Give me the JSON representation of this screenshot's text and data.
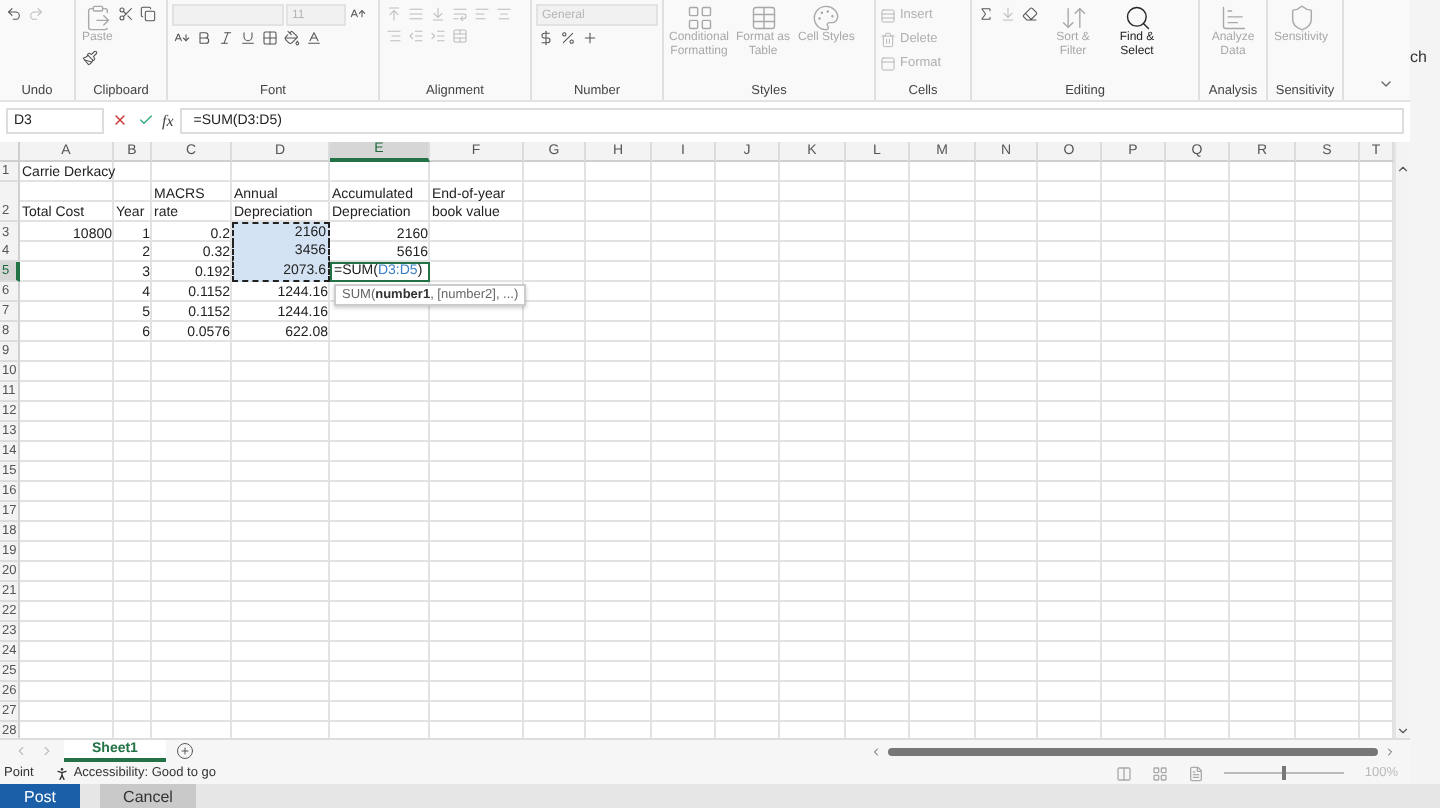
{
  "ribbon": {
    "groups": [
      {
        "label": "Undo",
        "items": [
          {
            "kind": "icon",
            "disabled": false
          },
          {
            "kind": "icon",
            "disabled": true
          }
        ]
      },
      {
        "label": "Clipboard",
        "items": [
          {
            "kind": "big",
            "label": "Paste",
            "disabled": true
          },
          {
            "kind": "icon",
            "disabled": false
          },
          {
            "kind": "icon",
            "disabled": false
          },
          {
            "kind": "icon",
            "disabled": false
          }
        ]
      },
      {
        "label": "Font",
        "items": [
          {
            "kind": "field",
            "disabled": true
          },
          {
            "kind": "field",
            "value": "11",
            "disabled": true
          },
          {
            "kind": "icon",
            "disabled": false
          },
          {
            "kind": "icon",
            "disabled": false
          },
          {
            "kind": "icon",
            "disabled": false
          },
          {
            "kind": "icon",
            "disabled": false
          },
          {
            "kind": "icon",
            "disabled": false
          },
          {
            "kind": "icon",
            "disabled": false
          },
          {
            "kind": "icon",
            "disabled": false
          },
          {
            "kind": "icon",
            "disabled": false
          }
        ]
      },
      {
        "label": "Alignment",
        "items": [
          {
            "kind": "icon",
            "disabled": true
          },
          {
            "kind": "icon",
            "disabled": true
          },
          {
            "kind": "icon",
            "disabled": true
          },
          {
            "kind": "icon",
            "disabled": true
          },
          {
            "kind": "icon",
            "disabled": true
          },
          {
            "kind": "icon",
            "disabled": true
          },
          {
            "kind": "icon",
            "disabled": true
          },
          {
            "kind": "icon",
            "disabled": true
          },
          {
            "kind": "icon",
            "disabled": true
          },
          {
            "kind": "icon",
            "disabled": true
          }
        ]
      },
      {
        "label": "Number",
        "items": [
          {
            "kind": "field",
            "value": "General",
            "disabled": true
          },
          {
            "kind": "icon",
            "disabled": false
          },
          {
            "kind": "icon",
            "disabled": false
          },
          {
            "kind": "icon",
            "disabled": false
          }
        ]
      },
      {
        "label": "Styles",
        "items": [
          {
            "kind": "big",
            "label": "Conditional Formatting",
            "disabled": true
          },
          {
            "kind": "big",
            "label": "Format as Table",
            "disabled": true
          },
          {
            "kind": "big",
            "label": "Cell Styles",
            "disabled": true
          }
        ]
      },
      {
        "label": "Cells",
        "items": [
          {
            "kind": "small",
            "label": "Insert",
            "disabled": true
          },
          {
            "kind": "small",
            "label": "Delete",
            "disabled": true
          },
          {
            "kind": "small",
            "label": "Format",
            "disabled": true
          }
        ]
      },
      {
        "label": "Editing",
        "items": [
          {
            "kind": "icon",
            "disabled": false
          },
          {
            "kind": "icon",
            "disabled": true
          },
          {
            "kind": "icon",
            "disabled": false
          },
          {
            "kind": "big",
            "label": "Sort & Filter",
            "disabled": true
          },
          {
            "kind": "big",
            "label": "Find & Select",
            "disabled": false
          }
        ]
      },
      {
        "label": "Analysis",
        "items": [
          {
            "kind": "big",
            "label": "Analyze Data",
            "disabled": true
          }
        ]
      },
      {
        "label": "Sensitivity",
        "items": [
          {
            "kind": "big",
            "label": "Sensitivity",
            "disabled": true
          }
        ]
      }
    ]
  },
  "formula_bar": {
    "name_box": "D3",
    "function_label": "fx",
    "formula": "=SUM(D3:D5)"
  },
  "columns": [
    {
      "label": "A",
      "selected": false
    },
    {
      "label": "B",
      "selected": false
    },
    {
      "label": "C",
      "selected": false
    },
    {
      "label": "D",
      "selected": false
    },
    {
      "label": "E",
      "selected": true
    },
    {
      "label": "F",
      "selected": false
    },
    {
      "label": "G",
      "selected": false
    },
    {
      "label": "H",
      "selected": false
    },
    {
      "label": "I",
      "selected": false
    },
    {
      "label": "J",
      "selected": false
    },
    {
      "label": "K",
      "selected": false
    },
    {
      "label": "L",
      "selected": false
    },
    {
      "label": "M",
      "selected": false
    },
    {
      "label": "N",
      "selected": false
    },
    {
      "label": "O",
      "selected": false
    },
    {
      "label": "P",
      "selected": false
    },
    {
      "label": "Q",
      "selected": false
    },
    {
      "label": "R",
      "selected": false
    },
    {
      "label": "S",
      "selected": false
    },
    {
      "label": "T",
      "selected": false
    }
  ],
  "rows": [
    {
      "number": "1",
      "selected": false,
      "tall": false,
      "cells": [
        {
          "kind": "text",
          "text": "Carrie Derkacy"
        }
      ]
    },
    {
      "number": "2",
      "selected": false,
      "tall": true,
      "cells": [
        {
          "kind": "text",
          "text": "Total Cost"
        },
        {
          "kind": "text",
          "text": "Year"
        },
        {
          "kind": "text",
          "text": "MACRS rate"
        },
        {
          "kind": "text",
          "text": "Annual Depreciation"
        },
        {
          "kind": "text",
          "text": "Accumulated Depreciation"
        },
        {
          "kind": "text",
          "text": "End-of-year book value"
        }
      ]
    },
    {
      "number": "3",
      "selected": false,
      "tall": false,
      "cells": [
        {
          "kind": "number",
          "text": "10800"
        },
        {
          "kind": "number",
          "text": "1"
        },
        {
          "kind": "number",
          "text": "0.2"
        },
        {
          "kind": "number",
          "text": "2160",
          "in_range": true
        },
        {
          "kind": "number",
          "text": "2160"
        }
      ]
    },
    {
      "number": "4",
      "selected": false,
      "tall": false,
      "cells": [
        {
          "kind": "empty"
        },
        {
          "kind": "number",
          "text": "2"
        },
        {
          "kind": "number",
          "text": "0.32"
        },
        {
          "kind": "number",
          "text": "3456",
          "in_range": true
        },
        {
          "kind": "number",
          "text": "5616"
        }
      ]
    },
    {
      "number": "5",
      "selected": true,
      "tall": false,
      "cells": [
        {
          "kind": "empty"
        },
        {
          "kind": "number",
          "text": "3"
        },
        {
          "kind": "number",
          "text": "0.192"
        },
        {
          "kind": "number",
          "text": "2073.6",
          "in_range": true
        },
        {
          "kind": "edit",
          "parts": [
            {
              "text": "=SUM(",
              "color": "#222222"
            },
            {
              "text": "D3:D5",
              "color": "#3b7fc4"
            },
            {
              "text": ")",
              "color": "#222222"
            }
          ]
        }
      ]
    },
    {
      "number": "6",
      "selected": false,
      "tall": false,
      "cells": [
        {
          "kind": "empty"
        },
        {
          "kind": "number",
          "text": "4"
        },
        {
          "kind": "number",
          "text": "0.1152"
        },
        {
          "kind": "number",
          "text": "1244.16"
        }
      ]
    },
    {
      "number": "7",
      "selected": false,
      "tall": false,
      "cells": [
        {
          "kind": "empty"
        },
        {
          "kind": "number",
          "text": "5"
        },
        {
          "kind": "number",
          "text": "0.1152"
        },
        {
          "kind": "number",
          "text": "1244.16"
        }
      ]
    },
    {
      "number": "8",
      "selected": false,
      "tall": false,
      "cells": [
        {
          "kind": "empty"
        },
        {
          "kind": "number",
          "text": "6"
        },
        {
          "kind": "number",
          "text": "0.0576"
        },
        {
          "kind": "number",
          "text": "622.08"
        }
      ]
    },
    {
      "number": "9",
      "selected": false,
      "tall": false
    },
    {
      "number": "10",
      "selected": false,
      "tall": false
    },
    {
      "number": "11",
      "selected": false,
      "tall": false
    },
    {
      "number": "12",
      "selected": false,
      "tall": false
    },
    {
      "number": "13",
      "selected": false,
      "tall": false
    },
    {
      "number": "14",
      "selected": false,
      "tall": false
    },
    {
      "number": "15",
      "selected": false,
      "tall": false
    },
    {
      "number": "16",
      "selected": false,
      "tall": false
    },
    {
      "number": "17",
      "selected": false,
      "tall": false
    },
    {
      "number": "18",
      "selected": false,
      "tall": false
    },
    {
      "number": "19",
      "selected": false,
      "tall": false
    },
    {
      "number": "20",
      "selected": false,
      "tall": false
    },
    {
      "number": "21",
      "selected": false,
      "tall": false
    },
    {
      "number": "22",
      "selected": false,
      "tall": false
    },
    {
      "number": "23",
      "selected": false,
      "tall": false
    },
    {
      "number": "24",
      "selected": false,
      "tall": false
    },
    {
      "number": "25",
      "selected": false,
      "tall": false
    },
    {
      "number": "26",
      "selected": false,
      "tall": false
    },
    {
      "number": "27",
      "selected": false,
      "tall": false
    },
    {
      "number": "28",
      "selected": false,
      "tall": false
    }
  ],
  "tooltip": "SUM(**number1**, [number2], ...)",
  "sheet_tabs": [
    {
      "label": "Sheet1",
      "selected": true
    }
  ],
  "status_bar": {
    "mode": "Point",
    "accessibility": "Accessibility: Good to go",
    "zoom": "100%",
    "zoom_slider": {
      "level": 0.5
    }
  },
  "background": {
    "side_text": "ch",
    "buttons": [
      {
        "label": "Post",
        "kind": "primary"
      },
      {
        "label": "Cancel",
        "kind": "secondary"
      }
    ]
  }
}
